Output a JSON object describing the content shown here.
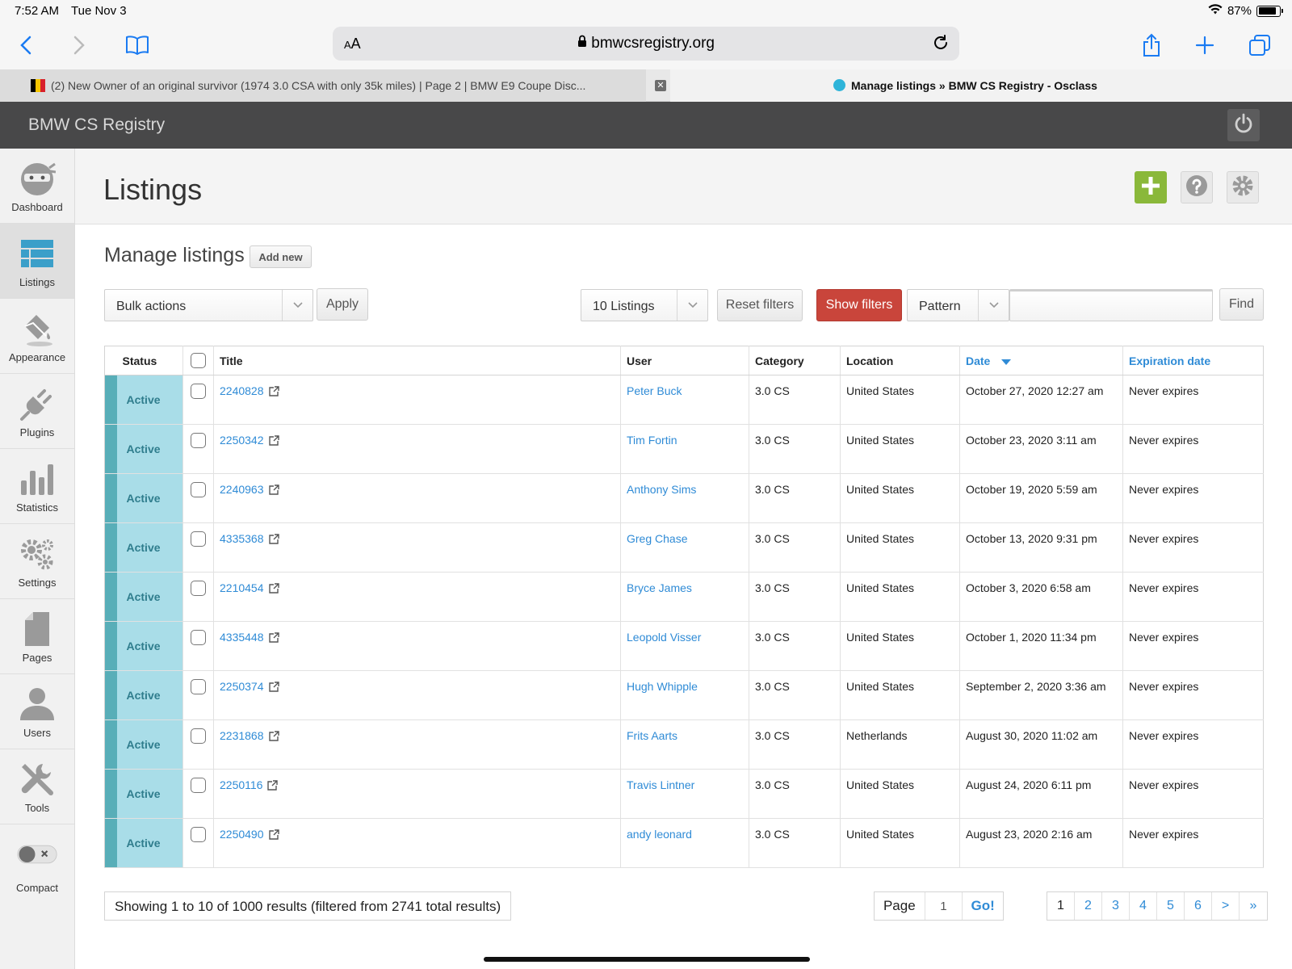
{
  "status_bar": {
    "time": "7:52 AM",
    "date": "Tue Nov 3",
    "battery": "87%"
  },
  "browser": {
    "url": "bmwcsregistry.org",
    "text_size_label": "AA",
    "tabs": [
      {
        "title": "(2) New Owner of an original survivor (1974 3.0 CSA with only 35k miles) | Page 2 | BMW E9 Coupe Disc...",
        "active": false
      },
      {
        "title": "Manage listings » BMW CS Registry - Osclass",
        "active": true
      }
    ]
  },
  "app": {
    "brand": "BMW CS Registry"
  },
  "sidebar": {
    "items": [
      {
        "label": "Dashboard",
        "icon": "ninja-icon"
      },
      {
        "label": "Listings",
        "icon": "list-icon",
        "active": true
      },
      {
        "label": "Appearance",
        "icon": "paint-bucket-icon"
      },
      {
        "label": "Plugins",
        "icon": "plug-icon"
      },
      {
        "label": "Statistics",
        "icon": "bar-chart-icon"
      },
      {
        "label": "Settings",
        "icon": "gears-icon"
      },
      {
        "label": "Pages",
        "icon": "page-icon"
      },
      {
        "label": "Users",
        "icon": "user-icon"
      },
      {
        "label": "Tools",
        "icon": "tools-icon"
      },
      {
        "label": "Compact",
        "icon": "toggle-icon"
      }
    ]
  },
  "page": {
    "title": "Listings",
    "subtitle": "Manage listings",
    "add_new": "Add new"
  },
  "toolbar": {
    "bulk_actions": "Bulk actions",
    "apply": "Apply",
    "per_page": "10 Listings",
    "reset_filters": "Reset filters",
    "show_filters": "Show filters",
    "pattern": "Pattern",
    "search_value": "",
    "find": "Find"
  },
  "table": {
    "headers": [
      "Status",
      "Title",
      "User",
      "Category",
      "Location",
      "Date",
      "Expiration date"
    ],
    "rows": [
      {
        "status": "Active",
        "title": "2240828",
        "user": "Peter Buck",
        "category": "3.0 CS",
        "location": "United States",
        "date": "October 27, 2020 12:27 am",
        "expiration": "Never expires"
      },
      {
        "status": "Active",
        "title": "2250342",
        "user": "Tim Fortin",
        "category": "3.0 CS",
        "location": "United States",
        "date": "October 23, 2020 3:11 am",
        "expiration": "Never expires"
      },
      {
        "status": "Active",
        "title": "2240963",
        "user": "Anthony Sims",
        "category": "3.0 CS",
        "location": "United States",
        "date": "October 19, 2020 5:59 am",
        "expiration": "Never expires"
      },
      {
        "status": "Active",
        "title": "4335368",
        "user": "Greg Chase",
        "category": "3.0 CS",
        "location": "United States",
        "date": "October 13, 2020 9:31 pm",
        "expiration": "Never expires"
      },
      {
        "status": "Active",
        "title": "2210454",
        "user": "Bryce James",
        "category": "3.0 CS",
        "location": "United States",
        "date": "October 3, 2020 6:58 am",
        "expiration": "Never expires"
      },
      {
        "status": "Active",
        "title": "4335448",
        "user": "Leopold Visser",
        "category": "3.0 CS",
        "location": "United States",
        "date": "October 1, 2020 11:34 pm",
        "expiration": "Never expires"
      },
      {
        "status": "Active",
        "title": "2250374",
        "user": "Hugh Whipple",
        "category": "3.0 CS",
        "location": "United States",
        "date": "September 2, 2020 3:36 am",
        "expiration": "Never expires"
      },
      {
        "status": "Active",
        "title": "2231868",
        "user": "Frits Aarts",
        "category": "3.0 CS",
        "location": "Netherlands",
        "date": "August 30, 2020 11:02 am",
        "expiration": "Never expires"
      },
      {
        "status": "Active",
        "title": "2250116",
        "user": "Travis Lintner",
        "category": "3.0 CS",
        "location": "United States",
        "date": "August 24, 2020 6:11 pm",
        "expiration": "Never expires"
      },
      {
        "status": "Active",
        "title": "2250490",
        "user": "andy leonard",
        "category": "3.0 CS",
        "location": "United States",
        "date": "August 23, 2020 2:16 am",
        "expiration": "Never expires"
      }
    ]
  },
  "footer": {
    "showing": "Showing 1 to 10 of 1000 results (filtered from 2741 total results)",
    "page_label": "Page",
    "page_value": "1",
    "go": "Go!",
    "pages": [
      "1",
      "2",
      "3",
      "4",
      "5",
      "6",
      ">",
      "»"
    ]
  },
  "colors": {
    "accent_link": "#2f8bd6",
    "status_strip": "#58aeb8",
    "status_bg": "#a9dde8",
    "show_filters": "#c9453b",
    "add_button": "#8ab83a",
    "header_bg": "#484849"
  }
}
